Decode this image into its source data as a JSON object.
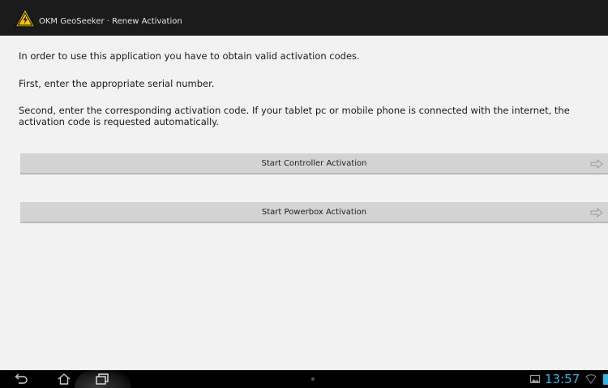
{
  "app": {
    "title": "OKM GeoSeeker · Renew Activation",
    "accent_color": "#f5c400"
  },
  "content": {
    "paragraph_1": "In order to use this application you have to obtain valid activation codes.",
    "paragraph_2": "First, enter the appropriate serial number.",
    "paragraph_3": "Second, enter the corresponding activation code. If your tablet pc or mobile phone is connected with the internet, the activation code is requested automatically."
  },
  "buttons": {
    "controller_activation": "Start Controller Activation",
    "powerbox_activation": "Start Powerbox Activation",
    "arrow_icon": "arrow-right-icon"
  },
  "system_bar": {
    "clock": "13:57",
    "clock_color": "#33b5e5",
    "icons": [
      "back-icon",
      "home-icon",
      "recent-apps-icon",
      "gallery-notification-icon",
      "wifi-icon",
      "battery-icon"
    ]
  }
}
